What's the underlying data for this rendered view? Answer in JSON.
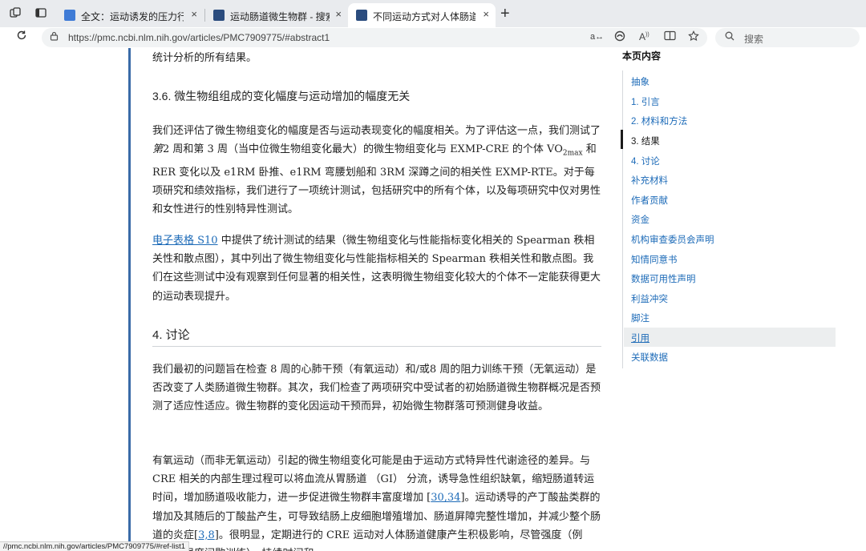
{
  "tabs": [
    {
      "title": "全文：运动诱发的压力行为，肠道",
      "favicon_color": "#3f7bd6"
    },
    {
      "title": "运动肠道微生物群 - 搜索结果 - Pu",
      "favicon_color": "#2b4c7e"
    },
    {
      "title": "不同运动方式对人体肠道微生物组",
      "favicon_color": "#2b4c7e"
    }
  ],
  "icons": {
    "close": "×",
    "new_tab": "+"
  },
  "address": {
    "url": "https://pmc.ncbi.nlm.nih.gov/articles/PMC7909775/#abstract1",
    "search_placeholder": "搜索"
  },
  "article": {
    "p0": "统计分析的所有结果。",
    "h36": "3.6. 微生物组组成的变化幅度与运动增加的幅度无关",
    "p1_a": "我们还评估了微生物组变化的幅度是否与运动表现变化的幅度相关。为了评估这一点，我们测试了",
    "p1_em": "第",
    "p1_b": "2 周和第 3 周（当中位微生物组变化最大）的微生物组变化与 EXMP-CRE 的个体 VO",
    "p1_sub": "2max",
    "p1_c": " 和 RER 变化以及 e1RM 卧推、e1RM 弯腰划船和 3RM 深蹲之间的相关性 EXMP-RTE。对于每项研究和绩效指标，我们进行了一项统计测试，包括研究中的所有个体，以及每项研究中仅对男性和女性进行的性别特异性测试。",
    "p2_link": "电子表格 S10",
    "p2_text": " 中提供了统计测试的结果（微生物组变化与性能指标变化相关的 Spearman 秩相关性和散点图），其中列出了微生物组变化与性能指标相关的 Spearman 秩相关性和散点图。我们在这些测试中没有观察到任何显著的相关性，这表明微生物组变化较大的个体不一定能获得更大的运动表现提升。",
    "h4": "4. 讨论",
    "p3": "我们最初的问题旨在检查 8 周的心肺干预（有氧运动）和/或8 周的阻力训练干预（无氧运动）是否改变了人类肠道微生物群。其次，我们检查了两项研究中受试者的初始肠道微生物群概况是否预测了适应性适应。微生物群的变化因运动干预而异，初始微生物群落可预测健身收益。",
    "p4_a": "有氧运动（而非无氧运动）引起的微生物组变化可能是由于运动方式特异性代谢途径的差异。与 CRE 相关的内部生理过程可以将血流从胃肠道 （GI） 分流，诱导急性组织缺氧，缩短肠道转运时间，增加肠道吸收能力，进一步促进微生物群丰富度增加 [",
    "p4_ref1": "30,34",
    "p4_b": "]。运动诱导的产丁酸盐类群的增加及其随后的丁酸盐产生，可导致结肠上皮细胞增殖增加、肠道屏障完整性增加，并减少整个肠道的炎症[",
    "p4_ref2": "3,8",
    "p4_c": "]。很明显，定期进行的 CRE 运动对人体肠道健康产生积极影响，尽管强度（例如，高强度间歇训练）、持续时间和"
  },
  "toc": {
    "title": "本页内容",
    "items": [
      "抽象",
      "1. 引言",
      "2. 材料和方法",
      "3. 结果",
      "4. 讨论",
      "补充材料",
      "作者贡献",
      "资金",
      "机构审查委员会声明",
      "知情同意书",
      "数据可用性声明",
      "利益冲突",
      "脚注",
      "引用",
      "关联数据"
    ],
    "current": "3. 结果",
    "highlighted": "引用"
  },
  "status_url": "//pmc.ncbi.nlm.nih.gov/articles/PMC7909775/#ref-list1"
}
